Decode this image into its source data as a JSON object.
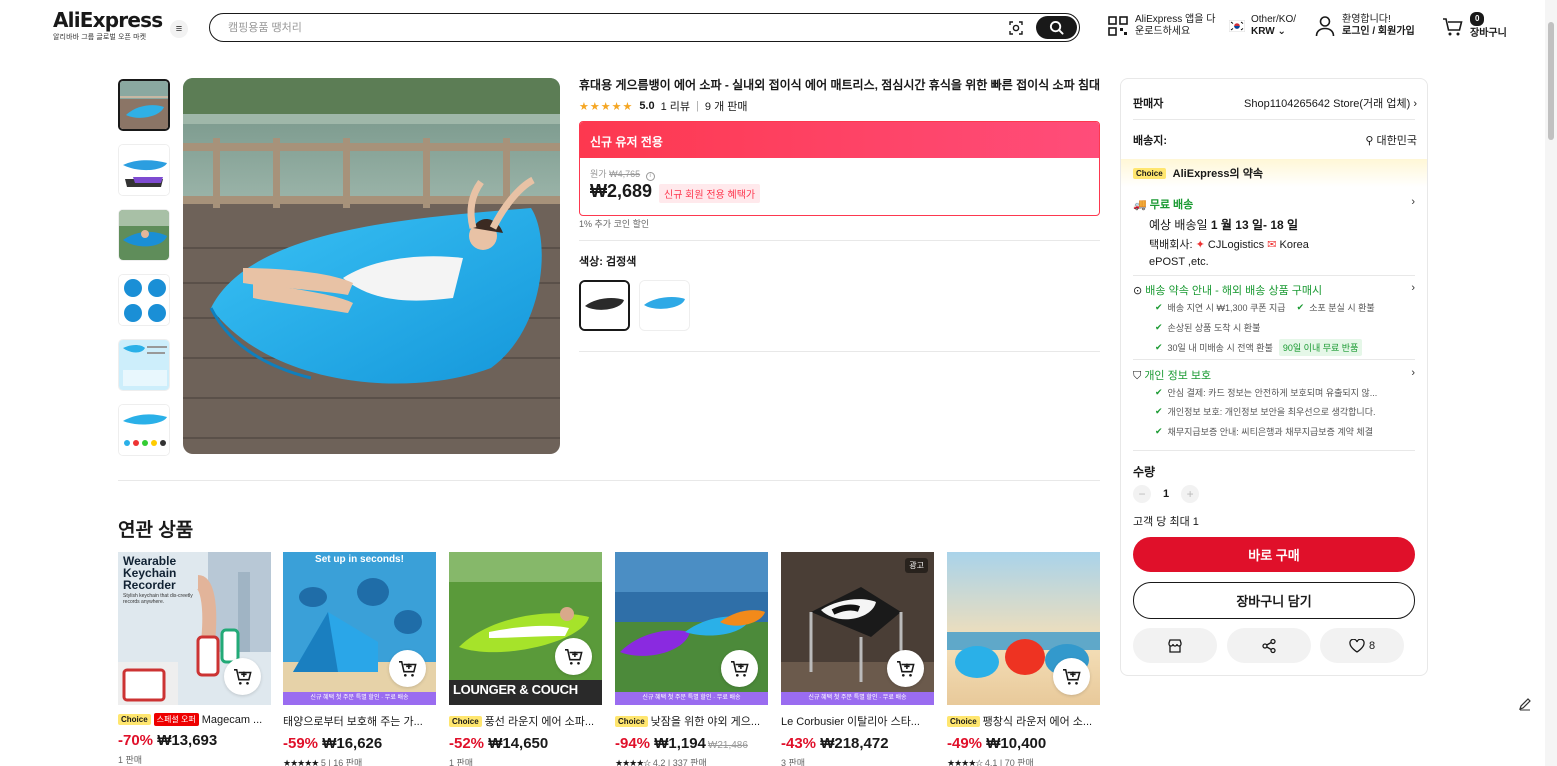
{
  "header": {
    "logo": "AliExpress",
    "logo_sub": "알리바바 그룹 글로벌 오픈 마켓",
    "search_placeholder": "캠핑용품 땡처리",
    "app_line1": "AliExpress 앱을 다",
    "app_line2": "운로드하세요",
    "region_line1": "Other/KO/",
    "region_line2": "KRW",
    "user_line1": "환영합니다!",
    "user_line2": "로그인 / 회원가입",
    "cart_count": "0",
    "cart_label": "장바구니"
  },
  "product": {
    "title": "휴대용 게으름뱅이 에어 소파 - 실내외 접이식 에어 매트리스, 점심시간 휴식을 위한 빠른 접이식 소파 침대",
    "stars": "★★★★★",
    "rating": "5.0",
    "reviews": "1 리뷰",
    "sold": "9 개 판매",
    "promo_header": "신규 유저 전용",
    "orig_label": "원가",
    "orig_price": "₩4,765",
    "price": "₩2,689",
    "price_tag": "신규 회원 전용 혜택가",
    "coin_note": "1% 추가 코인 할인",
    "color_label": "색상: 검정색"
  },
  "related": {
    "title": "연관 상품",
    "items": [
      {
        "choice": "Choice",
        "super": "스페셜 오퍼",
        "title": "Magecam ...",
        "discount": "-70%",
        "price": "₩13,693",
        "orig": "",
        "sub": "1 판매",
        "stars": ""
      },
      {
        "choice": "",
        "super": "",
        "title": "태양으로부터 보호해 주는 가...",
        "discount": "-59%",
        "price": "₩16,626",
        "orig": "",
        "sub": "5 | 16 판매",
        "stars": "★★★★★"
      },
      {
        "choice": "Choice",
        "super": "",
        "title": "풍선 라운지 에어 소파...",
        "discount": "-52%",
        "price": "₩14,650",
        "orig": "",
        "sub": "1 판매",
        "stars": ""
      },
      {
        "choice": "Choice",
        "super": "",
        "title": "낮잠을 위한 야외 게으...",
        "discount": "-94%",
        "price": "₩1,194",
        "orig": "₩21,486",
        "sub": "4.2 | 337 판매",
        "stars": "★★★★☆"
      },
      {
        "choice": "",
        "super": "",
        "title": "Le Corbusier 이탈리아 스타...",
        "discount": "-43%",
        "price": "₩218,472",
        "orig": "",
        "sub": "3 판매",
        "stars": ""
      },
      {
        "choice": "Choice",
        "super": "",
        "title": "팽창식 라운저 에어 소...",
        "discount": "-49%",
        "price": "₩10,400",
        "orig": "",
        "sub": "4.1 | 70 판매",
        "stars": "★★★★☆"
      }
    ],
    "image_texts": {
      "keychain_l1": "Wearable",
      "keychain_l2": "Keychain",
      "keychain_l3": "Recorder",
      "keychain_small": "Stylish keychain that dis-creetly records anywhere.",
      "tent": "Set up in seconds!",
      "lounger": "LOUNGER & COUCH",
      "promo_strip": "신규 혜택 첫 주문 특별 할인 · 무료 배송",
      "ad": "광고"
    }
  },
  "panel": {
    "seller_label": "판매자",
    "seller_value": "Shop1104265642 Store(거래 업체)",
    "ship_to_label": "배송지:",
    "ship_to_value": "대한민국",
    "choice_badge": "Choice",
    "promise_title": "AliExpress의 약속",
    "free_ship": "무료 배송",
    "eta_prefix": "예상 배송일",
    "eta": "1 월 13 일- 18 일",
    "carrier_label": "택배회사:",
    "carrier1": "CJLogistics",
    "carrier2": "Korea",
    "carrier3": "ePOST ,etc.",
    "delivery_promise": "배송 약속 안내 - 해외 배송 상품 구매시",
    "dp1": "배송 지연 시 ₩1,300 쿠폰 지급",
    "dp2": "소포 분실 시 환불",
    "dp3": "손상된 상품 도착 시 환불",
    "dp4": "30일 내 미배송 시 전액 환불",
    "dp4_tag": "90일 이내 무료 반품",
    "privacy": "개인 정보 보호",
    "pv1": "안심 결제: 카드 정보는 안전하게 보호되며 유출되지 않...",
    "pv2": "개인정보 보호: 개인정보 보안을 최우선으로 생각합니다.",
    "pv3": "채무지급보증 안내: 씨티은행과 채무지급보증 계약 체결",
    "qty_label": "수량",
    "qty_value": "1",
    "max_note": "고객 당 최대 1",
    "buy_now": "바로 구매",
    "add_cart": "장바구니 담기",
    "wish_count": "8"
  },
  "colors": {
    "accent_red": "#e0102a",
    "choice_yellow": "#ffe66f",
    "green": "#1a9a32",
    "promo_pink": "#fd384f"
  }
}
